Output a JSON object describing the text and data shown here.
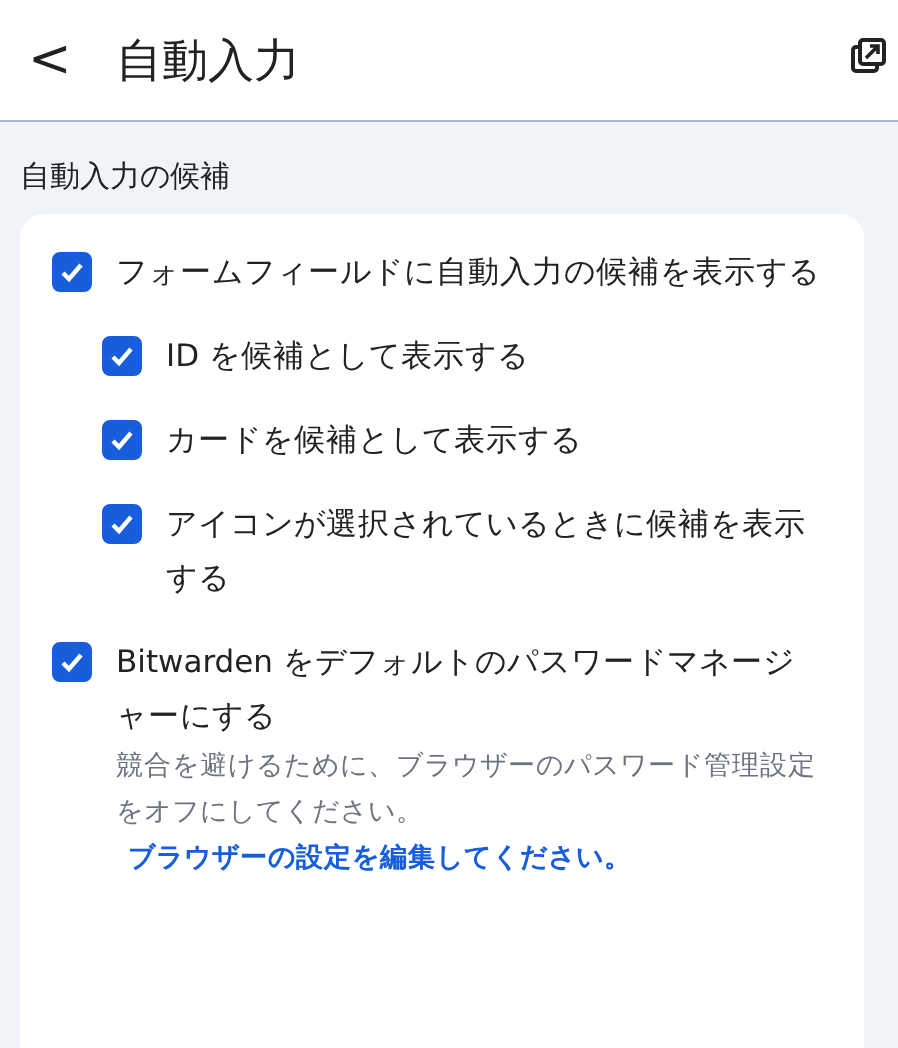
{
  "header": {
    "back": "<",
    "title": "自動入力"
  },
  "section": {
    "title": "自動入力の候補",
    "options": [
      {
        "label": "フォームフィールドに自動入力の候補を表示する",
        "checked": true,
        "children": [
          {
            "label": "ID を候補として表示する",
            "checked": true
          },
          {
            "label": "カードを候補として表示する",
            "checked": true
          },
          {
            "label": "アイコンが選択されているときに候補を表示する",
            "checked": true
          }
        ]
      },
      {
        "label": "Bitwarden をデフォルトのパスワードマネージャーにする",
        "checked": true,
        "hint": "競合を避けるために、ブラウザーのパスワード管理設定をオフにしてください。",
        "link": "ブラウザーの設定を編集してください。"
      }
    ]
  }
}
